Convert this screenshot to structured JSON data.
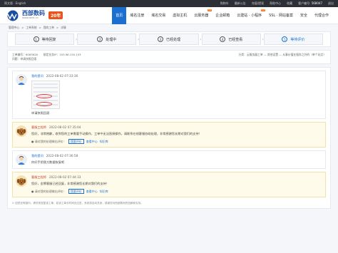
{
  "topbar": {
    "lang": "简文版 · English",
    "cart": "购物车",
    "msgs": "最新公告",
    "recharge": "充值/提现",
    "help": "帮助中心",
    "fav": "收藏",
    "account_prefix": "客户编号",
    "account": "568047",
    "logout": "退出"
  },
  "header": {
    "brand": "西部数码",
    "url": "www.west.cn",
    "badge": "20年",
    "nav": [
      {
        "label": "首页",
        "active": true,
        "hot": ""
      },
      {
        "label": "域名注册",
        "active": false,
        "hot": ""
      },
      {
        "label": "域名交易",
        "active": false,
        "hot": ""
      },
      {
        "label": "虚拟主机",
        "active": false,
        "hot": ""
      },
      {
        "label": "云服务器",
        "active": false,
        "hot": "hot"
      },
      {
        "label": "企业邮箱",
        "active": false,
        "hot": ""
      },
      {
        "label": "云建站 · 小程序",
        "active": false,
        "hot": "hot"
      },
      {
        "label": "SSL · 网站备案",
        "active": false,
        "hot": ""
      },
      {
        "label": "安全",
        "active": false,
        "hot": ""
      },
      {
        "label": "代理合作",
        "active": false,
        "hot": ""
      }
    ]
  },
  "breadcrumb": [
    "管理中心",
    "工单系统",
    "我的工单",
    "详情"
  ],
  "steps": [
    {
      "num": "1",
      "label": "等待回复",
      "current": false
    },
    {
      "num": "2",
      "label": "处理中",
      "current": false
    },
    {
      "num": "3",
      "label": "已经处理",
      "current": false
    },
    {
      "num": "4",
      "label": "已经查看",
      "current": false
    },
    {
      "num": "5",
      "label": "等待评价",
      "current": true
    }
  ],
  "ticket": {
    "id_label": "工单编号：",
    "id": "6063628",
    "ip_label": "绑定业务IP：",
    "ip": "103.96.150.153",
    "cat_label": "分类：",
    "category": "云服务器工单 — 其他设置 — 从事价值在服务之外的（单个站点）",
    "title_label": "问题：",
    "title": "申请快照回滚"
  },
  "messages": [
    {
      "type": "user",
      "who": "我的提问",
      "time": "2022-08-02 07:33:36",
      "text": "申请快照回滚",
      "has_shot": true,
      "rate": false
    },
    {
      "type": "staff",
      "who": "客服工程师",
      "time": "2022-08-02 07:35:04",
      "text": "您好，非常抱歉，收到您的工单需要手动操作，工单中无法直接操作，请联系在线客服协助处理，非常感谢您长期对我们的支持！",
      "rate_prefix": "● 请对我的处理做出评价：",
      "rate_btn": "我要评价",
      "rate_center": "查看中心",
      "rate_link": "知识库",
      "rate": true
    },
    {
      "type": "user",
      "who": "我的提问",
      "time": "2022-08-02 07:36:58",
      "text": "你好手把我方数据恢复吧",
      "has_shot": false,
      "rate": false
    },
    {
      "type": "staff",
      "who": "客服工程师",
      "time": "2022-08-02 07:44:33",
      "text": "您好，金牌客服已经回复，非常感谢您长期对我们的支持！",
      "rate_prefix": "● 请对我的处理做出评价：",
      "rate_btn": "我要评价",
      "rate_center": "查看中心",
      "rate_link": "知识库",
      "rate": true
    }
  ],
  "footer_note": "⊙ 如您还有疑问，请尽快答复该工单，若该工单长时间无应答，系统将自动关闭，感谢您对西部数码的信赖和支持。"
}
